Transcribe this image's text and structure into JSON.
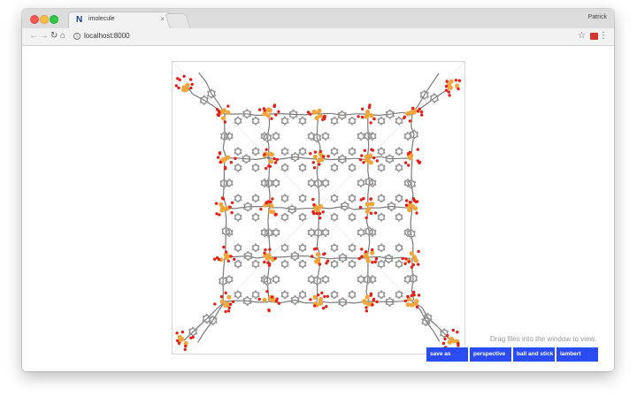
{
  "browser": {
    "tab": {
      "favicon": "N",
      "title": "imolecule",
      "close": "×"
    },
    "profile": "Patrick",
    "address": {
      "url": "localhost:8000"
    },
    "icons": {
      "back": "back-arrow-icon",
      "forward": "forward-arrow-icon",
      "reload": "reload-icon",
      "home": "home-icon",
      "info": "info-icon",
      "star": "star-icon",
      "menu": "kebab-menu-icon"
    },
    "glyphs": {
      "back": "←",
      "forward": "→",
      "reload": "↻",
      "home": "⌂",
      "info": "i",
      "star": "☆",
      "menu": "⋮"
    }
  },
  "app": {
    "hint": "Drag files into the window to view.",
    "buttons": {
      "save": "save as",
      "perspective": "perspective",
      "style": "ball and stick",
      "shader": "lambert"
    }
  },
  "colors": {
    "button_bg": "#2b4cf2",
    "oxygen": "#e4201b",
    "metal": "#f0a63a",
    "carbon": "#9a9a9a",
    "bond": "#7a7a7a"
  }
}
